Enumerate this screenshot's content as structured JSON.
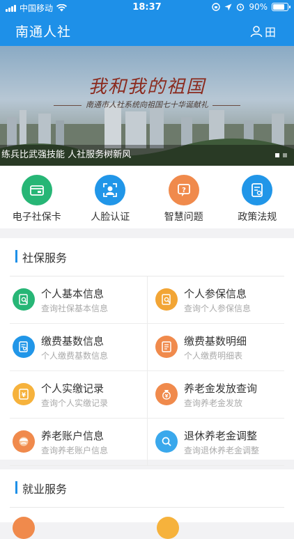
{
  "status": {
    "carrier": "中国移动",
    "time": "18:37",
    "battery": "90%",
    "battery_level": 0.9
  },
  "header": {
    "title": "南通人社",
    "user": "田"
  },
  "banner": {
    "slogan": "我和我的祖国",
    "subtitle": "南通市人社系统向祖国七十华诞献礼",
    "caption": "练兵比武强技能 人社服务树新风",
    "slide_count": 2,
    "active_slide": 1
  },
  "quick": [
    {
      "label": "电子社保卡",
      "icon": "card-icon",
      "color": "#27b676"
    },
    {
      "label": "人脸认证",
      "icon": "face-icon",
      "color": "#2196e8"
    },
    {
      "label": "智慧问题",
      "icon": "question-icon",
      "color": "#f08a4c"
    },
    {
      "label": "政策法规",
      "icon": "policy-icon",
      "color": "#2196e8"
    }
  ],
  "social": {
    "title": "社保服务",
    "items": [
      {
        "name": "个人基本信息",
        "desc": "查询社保基本信息",
        "icon": "search-doc-icon",
        "color": "#27b676"
      },
      {
        "name": "个人参保信息",
        "desc": "查询个人参保信息",
        "icon": "search-doc-icon",
        "color": "#f2a535"
      },
      {
        "name": "缴费基数信息",
        "desc": "个人缴费基数信息",
        "icon": "search-doc-icon",
        "color": "#2196e8"
      },
      {
        "name": "缴费基数明细",
        "desc": "个人缴费明细表",
        "icon": "list-doc-icon",
        "color": "#f08a4c"
      },
      {
        "name": "个人实缴记录",
        "desc": "查询个人实缴记录",
        "icon": "yen-doc-icon",
        "color": "#f6b23c"
      },
      {
        "name": "养老金发放查询",
        "desc": "查询养老金发放",
        "icon": "money-bag-icon",
        "color": "#f08a4c"
      },
      {
        "name": "养老账户信息",
        "desc": "查询养老账户信息",
        "icon": "elder-icon",
        "color": "#f08a4c"
      },
      {
        "name": "退休养老金调整",
        "desc": "查询退休养老金调整",
        "icon": "magnifier-icon",
        "color": "#3aa8ec"
      }
    ]
  },
  "employment": {
    "title": "就业服务"
  }
}
